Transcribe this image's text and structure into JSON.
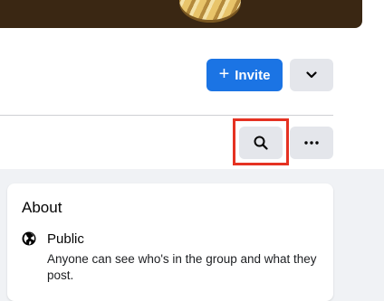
{
  "header": {
    "invite_label": "Invite",
    "invite_icon": "plus-icon",
    "dropdown_icon": "chevron-down-icon"
  },
  "tabs_bar": {
    "search_icon": "search-icon",
    "more_icon": "ellipsis-icon"
  },
  "about": {
    "title": "About",
    "privacy_icon": "globe-icon",
    "privacy_title": "Public",
    "privacy_description": "Anyone can see who's in the group and what they post."
  },
  "colors": {
    "primary": "#1b74e4",
    "secondary_button": "#e4e6eb",
    "highlight": "#e53222",
    "page_background": "#f0f2f5"
  }
}
